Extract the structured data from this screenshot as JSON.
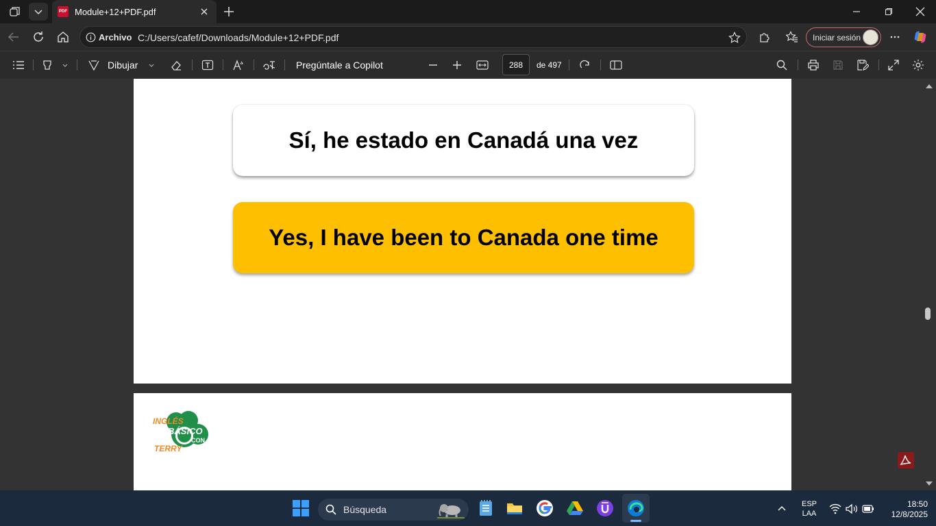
{
  "tab": {
    "title": "Module+12+PDF.pdf",
    "favicon_text": "PDF"
  },
  "address": {
    "security_label": "Archivo",
    "url": "C:/Users/cafef/Downloads/Module+12+PDF.pdf",
    "signin_label": "Iniciar sesión"
  },
  "pdf_toolbar": {
    "draw_label": "Dibujar",
    "copilot_label": "Pregúntale a Copilot",
    "page_current": "288",
    "page_total_label": "de 497"
  },
  "document": {
    "card_spanish": "Sí, he estado en Canadá una vez",
    "card_english": "Yes, I have been to Canada one time",
    "logo": {
      "line1": "INGLÉS",
      "line2": "BÁSICO",
      "line3": "CON",
      "line4": "TERRY"
    }
  },
  "taskbar": {
    "search_label": "Búsqueda",
    "lang_top": "ESP",
    "lang_bottom": "LAA",
    "time": "18:50",
    "date": "12/8/2025"
  },
  "colors": {
    "accent_card": "#fdbf00",
    "logo_green": "#1f8f4a",
    "logo_orange": "#f08a24",
    "edge_blue": "#0f7bd8"
  }
}
